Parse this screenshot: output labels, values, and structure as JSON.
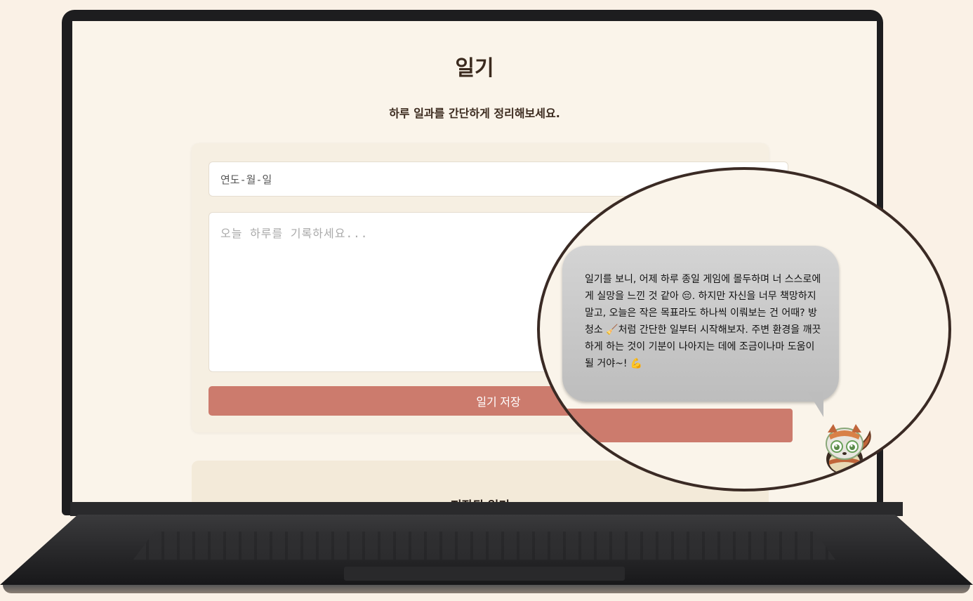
{
  "page": {
    "title": "일기",
    "subtitle": "하루 일과를 간단하게 정리해보세요."
  },
  "form": {
    "date_placeholder": "연도-월-일",
    "entry_placeholder": "오늘 하루를 기록하세요...",
    "save_label": "일기 저장"
  },
  "saved": {
    "title": "저장된 일기"
  },
  "chat_bubble": {
    "message": "일기를 보니, 어제 하루 종일 게임에 몰두하며 너 스스로에게 실망을 느낀 것 같아 😔. 하지만 자신을 너무 책망하지 말고, 오늘은 작은 목표라도 하나씩 이뤄보는 건 어때? 방 청소 🧹처럼 간단한 일부터 시작해보자. 주변 환경을 깨끗하게 하는 것이 기분이 나아지는 데에 조금이나마 도움이 될 거야~! 💪"
  },
  "colors": {
    "accent": "#cc7b6d",
    "background": "#faf4ea",
    "card": "#f6efe2",
    "text": "#3b2a1e"
  }
}
